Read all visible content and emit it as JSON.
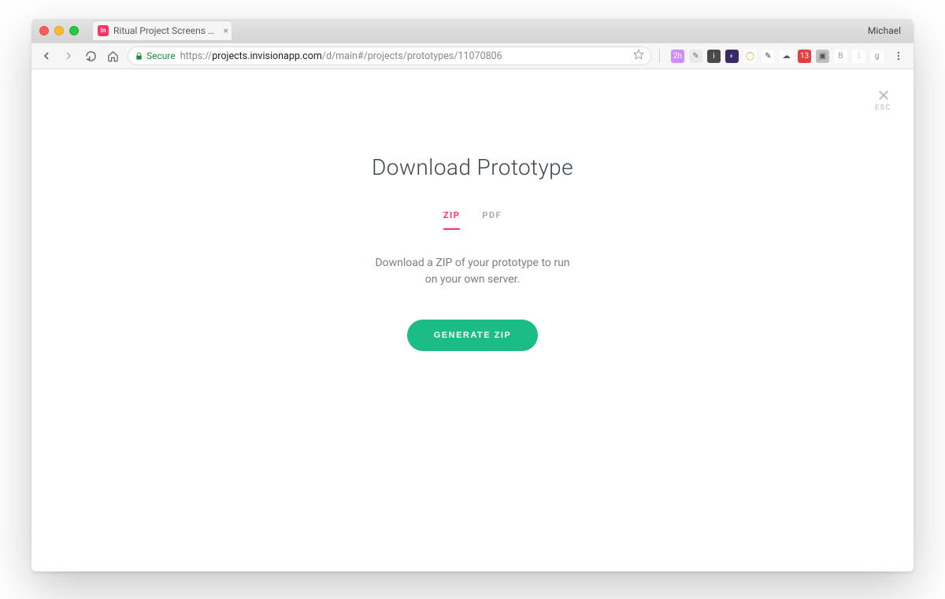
{
  "browser": {
    "profile_name": "Michael",
    "tab": {
      "favicon_text": "In",
      "title": "Ritual Project Screens - InVisio"
    },
    "security_label": "Secure",
    "url_prefix": "https://",
    "url_host": "projects.invisionapp.com",
    "url_path": "/d/main#/projects/prototypes/11070806"
  },
  "extensions": [
    {
      "name": "ext-2h",
      "bg": "#d08bff",
      "text": "2h",
      "fg": "#ffffff"
    },
    {
      "name": "ext-eyedrop",
      "bg": "#eaeaea",
      "text": "✎",
      "fg": "#666"
    },
    {
      "name": "ext-info",
      "bg": "#4a4a4a",
      "text": "i",
      "fg": "#ffffff"
    },
    {
      "name": "ext-moon",
      "bg": "#3a2a66",
      "text": "◐",
      "fg": "#d4b8ff"
    },
    {
      "name": "ext-circle",
      "bg": "#ffffff",
      "text": "◯",
      "fg": "#d4a017"
    },
    {
      "name": "ext-pencil",
      "bg": "#ffffff",
      "text": "✎",
      "fg": "#333"
    },
    {
      "name": "ext-cloud",
      "bg": "#ffffff",
      "text": "☁",
      "fg": "#5a5a5a"
    },
    {
      "name": "ext-calendar",
      "bg": "#e04040",
      "text": "13",
      "fg": "#ffffff"
    },
    {
      "name": "ext-save",
      "bg": "#bfbfbf",
      "text": "▣",
      "fg": "#555"
    },
    {
      "name": "ext-b",
      "bg": "#ffffff",
      "text": "B",
      "fg": "#9a9a9a"
    },
    {
      "name": "ext-bracket",
      "bg": "#ffffff",
      "text": "⟟",
      "fg": "#bbbbbb"
    },
    {
      "name": "ext-g",
      "bg": "#ffffff",
      "text": "g",
      "fg": "#8a8a8a"
    }
  ],
  "modal": {
    "title": "Download Prototype",
    "tabs": [
      {
        "label": "ZIP",
        "active": true
      },
      {
        "label": "PDF",
        "active": false
      }
    ],
    "description": "Download a ZIP of your prototype to run on your own server.",
    "close_label": "ESC",
    "primary_button": "GENERATE ZIP"
  }
}
